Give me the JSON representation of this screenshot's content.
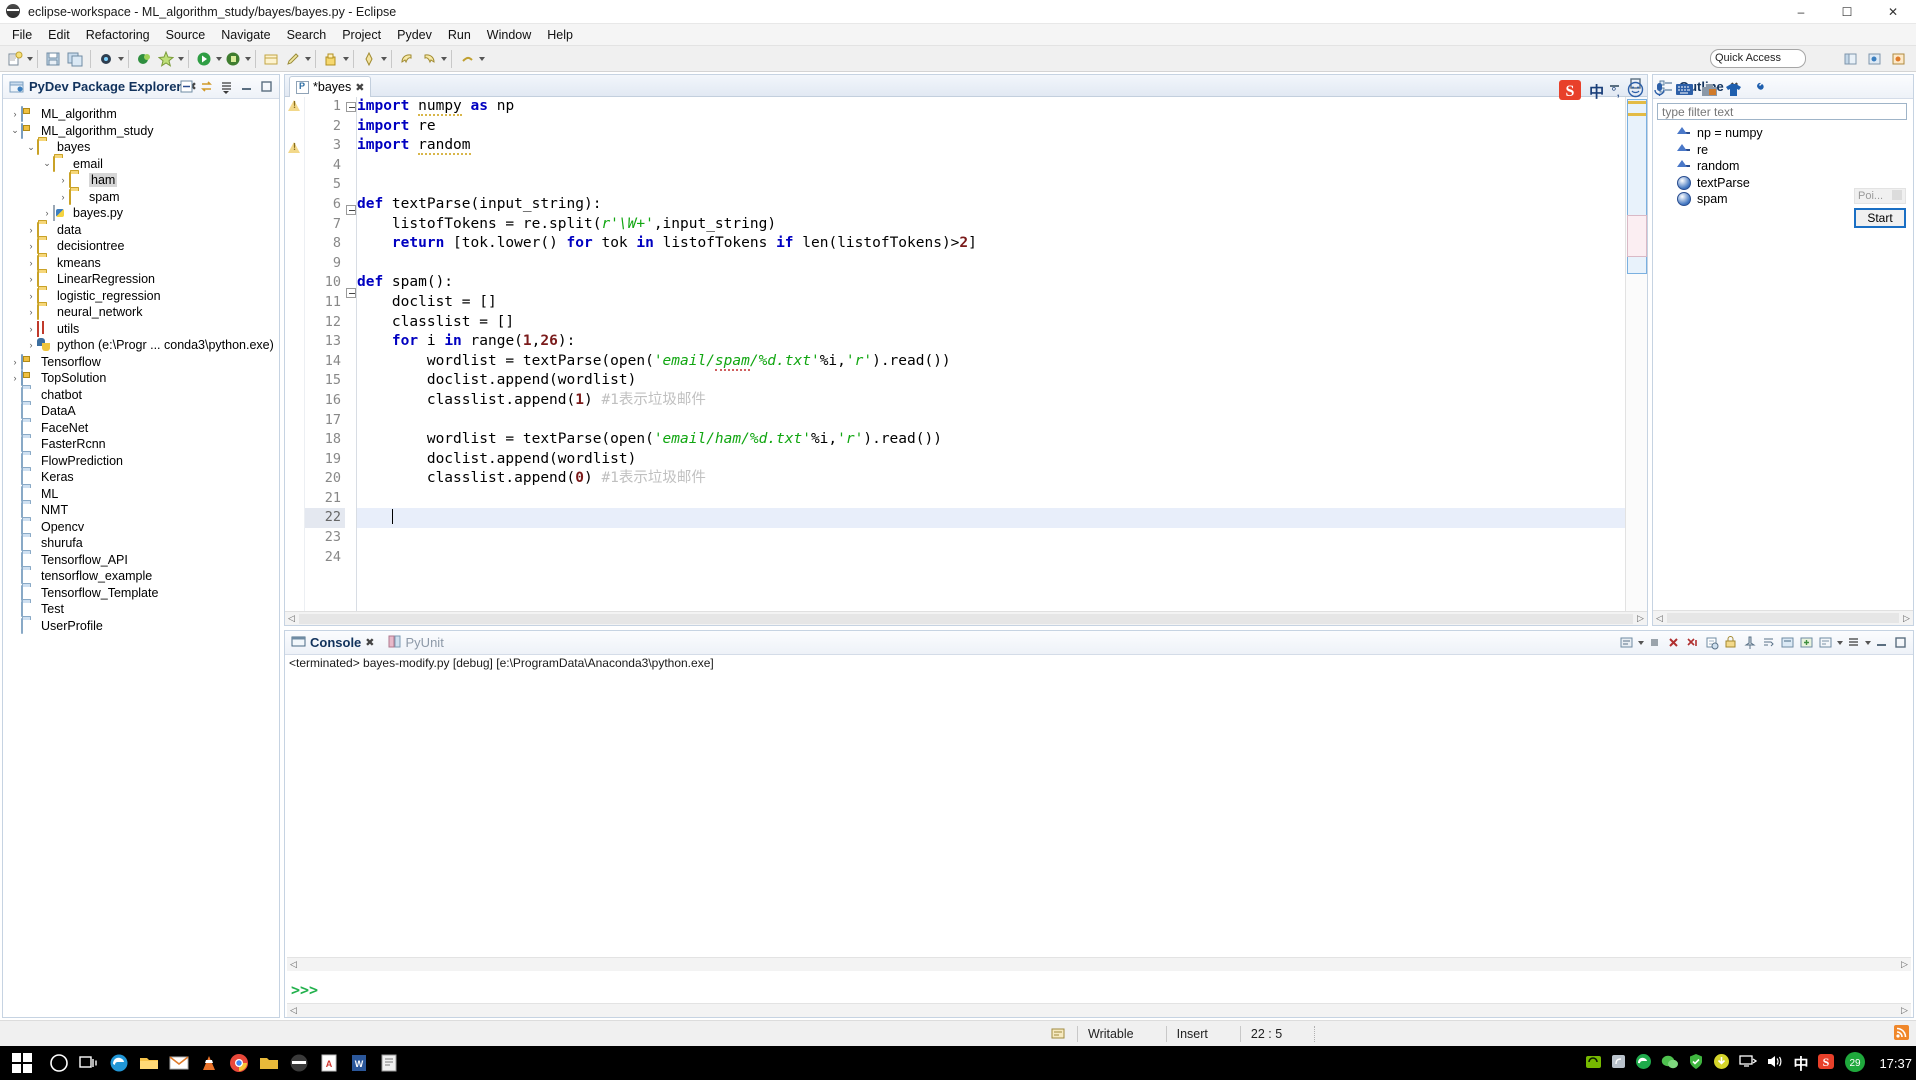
{
  "window": {
    "title": "eclipse-workspace - ML_algorithm_study/bayes/bayes.py - Eclipse",
    "app_icon": "eclipse-icon",
    "minimize": "–",
    "maximize": "☐",
    "close": "✕"
  },
  "menu": {
    "items": [
      "File",
      "Edit",
      "Refactoring",
      "Source",
      "Navigate",
      "Search",
      "Project",
      "Pydev",
      "Run",
      "Window",
      "Help"
    ]
  },
  "toolbar": {
    "quick_access": "Quick Access"
  },
  "package_explorer": {
    "title": "PyDev Package Explorer",
    "close_label": "✖",
    "tools": [
      "collapse-all-icon",
      "link-with-editor-icon",
      "view-menu-icon",
      "minimize-icon",
      "maximize-icon"
    ],
    "tree": [
      {
        "label": "ML_algorithm",
        "indent": 0,
        "arrow": "›",
        "icon": "project-icon",
        "selected": false
      },
      {
        "label": "ML_algorithm_study",
        "indent": 0,
        "arrow": "⌄",
        "icon": "project-icon",
        "selected": false
      },
      {
        "label": "bayes",
        "indent": 1,
        "arrow": "⌄",
        "icon": "folder-icon",
        "selected": false
      },
      {
        "label": "email",
        "indent": 2,
        "arrow": "⌄",
        "icon": "folder-icon",
        "selected": false
      },
      {
        "label": "ham",
        "indent": 3,
        "arrow": "›",
        "icon": "folder-icon",
        "selected": true
      },
      {
        "label": "spam",
        "indent": 3,
        "arrow": "›",
        "icon": "folder-icon",
        "selected": false
      },
      {
        "label": "bayes.py",
        "indent": 2,
        "arrow": "›",
        "icon": "python-file-icon",
        "selected": false
      },
      {
        "label": "data",
        "indent": 1,
        "arrow": "›",
        "icon": "folder-icon",
        "selected": false
      },
      {
        "label": "decisiontree",
        "indent": 1,
        "arrow": "›",
        "icon": "folder-icon",
        "selected": false
      },
      {
        "label": "kmeans",
        "indent": 1,
        "arrow": "›",
        "icon": "folder-icon",
        "selected": false
      },
      {
        "label": "LinearRegression",
        "indent": 1,
        "arrow": "›",
        "icon": "folder-icon",
        "selected": false
      },
      {
        "label": "logistic_regression",
        "indent": 1,
        "arrow": "›",
        "icon": "folder-icon",
        "selected": false
      },
      {
        "label": "neural_network",
        "indent": 1,
        "arrow": "›",
        "icon": "folder-icon",
        "selected": false
      },
      {
        "label": "utils",
        "indent": 1,
        "arrow": "›",
        "icon": "grid-icon",
        "selected": false
      },
      {
        "label": "python  (e:\\Progr ... conda3\\python.exe)",
        "indent": 1,
        "arrow": "›",
        "icon": "python-interpreter-icon",
        "selected": false
      },
      {
        "label": "Tensorflow",
        "indent": 0,
        "arrow": "›",
        "icon": "project-icon",
        "selected": false
      },
      {
        "label": "TopSolution",
        "indent": 0,
        "arrow": "›",
        "icon": "project-icon",
        "selected": false
      },
      {
        "label": "chatbot",
        "indent": 0,
        "arrow": "",
        "icon": "closed-project-icon",
        "selected": false
      },
      {
        "label": "DataA",
        "indent": 0,
        "arrow": "",
        "icon": "closed-project-icon",
        "selected": false
      },
      {
        "label": "FaceNet",
        "indent": 0,
        "arrow": "",
        "icon": "closed-project-icon",
        "selected": false
      },
      {
        "label": "FasterRcnn",
        "indent": 0,
        "arrow": "",
        "icon": "closed-project-icon",
        "selected": false
      },
      {
        "label": "FlowPrediction",
        "indent": 0,
        "arrow": "",
        "icon": "closed-project-icon",
        "selected": false
      },
      {
        "label": "Keras",
        "indent": 0,
        "arrow": "",
        "icon": "closed-project-icon",
        "selected": false
      },
      {
        "label": "ML",
        "indent": 0,
        "arrow": "",
        "icon": "closed-project-icon",
        "selected": false
      },
      {
        "label": "NMT",
        "indent": 0,
        "arrow": "",
        "icon": "closed-project-icon",
        "selected": false
      },
      {
        "label": "Opencv",
        "indent": 0,
        "arrow": "",
        "icon": "closed-project-icon",
        "selected": false
      },
      {
        "label": "shurufa",
        "indent": 0,
        "arrow": "",
        "icon": "closed-project-icon",
        "selected": false
      },
      {
        "label": "Tensorflow_API",
        "indent": 0,
        "arrow": "",
        "icon": "closed-project-icon",
        "selected": false
      },
      {
        "label": "tensorflow_example",
        "indent": 0,
        "arrow": "",
        "icon": "closed-project-icon",
        "selected": false
      },
      {
        "label": "Tensorflow_Template",
        "indent": 0,
        "arrow": "",
        "icon": "closed-project-icon",
        "selected": false
      },
      {
        "label": "Test",
        "indent": 0,
        "arrow": "",
        "icon": "closed-project-icon",
        "selected": false
      },
      {
        "label": "UserProfile",
        "indent": 0,
        "arrow": "",
        "icon": "closed-project-icon",
        "selected": false
      }
    ]
  },
  "editor": {
    "tab_label": "*bayes",
    "tab_close": "✖",
    "dirty": true,
    "cursor_line": 22,
    "lines": [
      {
        "n": 1,
        "warn": true,
        "fold": true,
        "text": "import numpy as np"
      },
      {
        "n": 2,
        "warn": false,
        "fold": false,
        "text": "import re"
      },
      {
        "n": 3,
        "warn": true,
        "fold": false,
        "text": "import random"
      },
      {
        "n": 4,
        "warn": false,
        "fold": false,
        "text": ""
      },
      {
        "n": 5,
        "warn": false,
        "fold": false,
        "text": ""
      },
      {
        "n": 6,
        "warn": false,
        "fold": true,
        "text": "def textParse(input_string):"
      },
      {
        "n": 7,
        "warn": false,
        "fold": false,
        "text": "    listofTokens = re.split(r'\\W+',input_string)"
      },
      {
        "n": 8,
        "warn": false,
        "fold": false,
        "text": "    return [tok.lower() for tok in listofTokens if len(listofTokens)>2]"
      },
      {
        "n": 9,
        "warn": false,
        "fold": false,
        "text": ""
      },
      {
        "n": 10,
        "warn": false,
        "fold": true,
        "text": "def spam():"
      },
      {
        "n": 11,
        "warn": false,
        "fold": false,
        "text": "    doclist = []"
      },
      {
        "n": 12,
        "warn": false,
        "fold": false,
        "text": "    classlist = []"
      },
      {
        "n": 13,
        "warn": false,
        "fold": false,
        "text": "    for i in range(1,26):"
      },
      {
        "n": 14,
        "warn": false,
        "fold": false,
        "text": "        wordlist = textParse(open('email/spam/%d.txt'%i,'r').read())"
      },
      {
        "n": 15,
        "warn": false,
        "fold": false,
        "text": "        doclist.append(wordlist)"
      },
      {
        "n": 16,
        "warn": false,
        "fold": false,
        "text": "        classlist.append(1) #1表示垃圾邮件"
      },
      {
        "n": 17,
        "warn": false,
        "fold": false,
        "text": ""
      },
      {
        "n": 18,
        "warn": false,
        "fold": false,
        "text": "        wordlist = textParse(open('email/ham/%d.txt'%i,'r').read())"
      },
      {
        "n": 19,
        "warn": false,
        "fold": false,
        "text": "        doclist.append(wordlist)"
      },
      {
        "n": 20,
        "warn": false,
        "fold": false,
        "text": "        classlist.append(0) #1表示垃圾邮件"
      },
      {
        "n": 21,
        "warn": false,
        "fold": false,
        "text": ""
      },
      {
        "n": 22,
        "warn": false,
        "fold": false,
        "text": ""
      },
      {
        "n": 23,
        "warn": false,
        "fold": false,
        "text": ""
      },
      {
        "n": 24,
        "warn": false,
        "fold": false,
        "text": ""
      }
    ]
  },
  "outline": {
    "title": "Outline",
    "close_label": "✖",
    "filter_placeholder": "type filter text",
    "items": [
      {
        "label": "np = numpy",
        "icon": "import-icon"
      },
      {
        "label": "re",
        "icon": "import-icon"
      },
      {
        "label": "random",
        "icon": "import-icon"
      },
      {
        "label": "textParse",
        "icon": "method-icon"
      },
      {
        "label": "spam",
        "icon": "method-icon"
      }
    ]
  },
  "console": {
    "tabs": [
      {
        "label": "Console",
        "active": true,
        "icon": "console-icon",
        "close": "✖"
      },
      {
        "label": "PyUnit",
        "active": false,
        "icon": "pyunit-icon",
        "close": ""
      }
    ],
    "terminated_line": "<terminated> bayes-modify.py [debug] [e:\\ProgramData\\Anaconda3\\python.exe]",
    "prompt": ">>>"
  },
  "statusbar": {
    "writable": "Writable",
    "insert": "Insert",
    "position": "22 : 5",
    "icon": "smart-insert-icon"
  },
  "ime": {
    "logo": "sogou-icon",
    "mode": "中",
    "buttons": [
      "punctuation-icon",
      "emoji-icon",
      "voice-icon",
      "keyboard-icon",
      "toolbox-icon",
      "skin-icon",
      "settings-icon"
    ]
  },
  "popup": {
    "label": "Poi...",
    "button": "Start"
  },
  "taskbar": {
    "start": "windows-start-icon",
    "pinned": [
      "cortana-icon",
      "task-view-icon",
      "edge-icon",
      "file-explorer-icon",
      "mail-icon",
      "vlc-icon",
      "chrome-icon",
      "folder-icon",
      "eclipse-icon",
      "pdf-icon",
      "word-icon",
      "notepad-icon"
    ],
    "tray": [
      "nvidia-icon",
      "nfc-icon",
      "edge-tray-icon",
      "wechat-icon",
      "security-icon",
      "update-icon",
      "network-icon",
      "volume-icon"
    ],
    "ime_mode": "中",
    "sogou": "S",
    "counter": "29",
    "clock": "17:37"
  }
}
